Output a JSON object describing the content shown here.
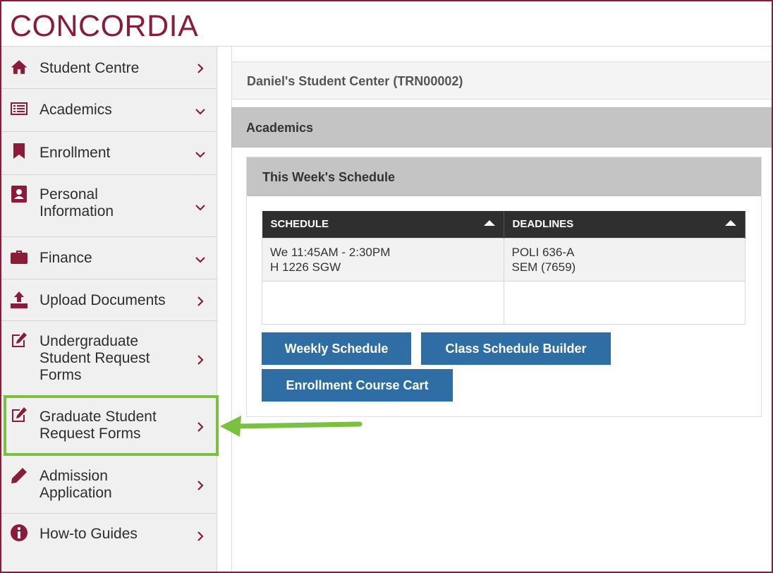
{
  "brand": {
    "logo_text": "CONCORDIA",
    "color": "#8a1c3a"
  },
  "sidebar": {
    "items": [
      {
        "label": "Student Centre",
        "icon": "home-icon",
        "chevron": "right"
      },
      {
        "label": "Academics",
        "icon": "list-icon",
        "chevron": "down"
      },
      {
        "label": "Enrollment",
        "icon": "bookmark-icon",
        "chevron": "down"
      },
      {
        "label": "Personal Information",
        "icon": "contact-book-icon",
        "chevron": "down"
      },
      {
        "label": "Finance",
        "icon": "briefcase-icon",
        "chevron": "down"
      },
      {
        "label": "Upload Documents",
        "icon": "upload-icon",
        "chevron": "right"
      },
      {
        "label": "Undergraduate Student Request Forms",
        "icon": "edit-icon",
        "chevron": "right"
      },
      {
        "label": "Graduate Student Request Forms",
        "icon": "edit-icon",
        "chevron": "right",
        "highlighted": true
      },
      {
        "label": "Admission Application",
        "icon": "pencil-icon",
        "chevron": "right"
      },
      {
        "label": "How-to Guides",
        "icon": "info-icon",
        "chevron": "right"
      }
    ]
  },
  "main": {
    "title": "Daniel's Student Center (TRN00002)",
    "section": "Academics",
    "schedule_panel": {
      "title": "This Week's Schedule",
      "columns": [
        "SCHEDULE",
        "DEADLINES"
      ],
      "rows": [
        {
          "schedule_line1": "We 11:45AM - 2:30PM",
          "schedule_line2": "H 1226 SGW",
          "deadline_line1": "POLI 636-A",
          "deadline_line2": "SEM (7659)"
        },
        {
          "schedule_line1": "",
          "schedule_line2": "",
          "deadline_line1": "",
          "deadline_line2": ""
        }
      ],
      "buttons": {
        "weekly": "Weekly Schedule",
        "builder": "Class Schedule Builder",
        "cart": "Enrollment Course Cart"
      }
    }
  },
  "colors": {
    "accent": "#8a1c3a",
    "button": "#2f6ea5",
    "highlight": "#7ac142",
    "table_header": "#2f2f2f"
  }
}
